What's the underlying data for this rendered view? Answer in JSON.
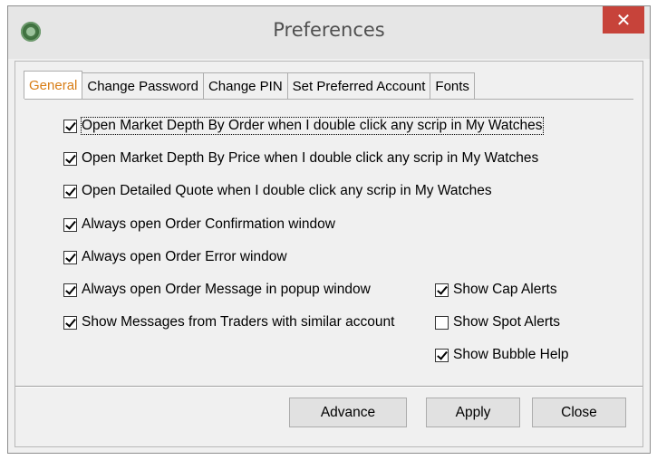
{
  "window": {
    "title": "Preferences",
    "close_glyph": "✕",
    "app_icon": "app-logo-icon"
  },
  "tabs": [
    {
      "label": "General",
      "active": true
    },
    {
      "label": "Change Password",
      "active": false
    },
    {
      "label": "Change PIN",
      "active": false
    },
    {
      "label": "Set Preferred Account",
      "active": false
    },
    {
      "label": "Fonts",
      "active": false
    }
  ],
  "options_left": [
    {
      "label": "Open Market Depth By Order when I double click any scrip in My Watches",
      "checked": true
    },
    {
      "label": "Open Market Depth By Price when I double click any scrip in My Watches",
      "checked": true
    },
    {
      "label": "Open Detailed Quote when I double click any scrip in My Watches",
      "checked": true
    },
    {
      "label": "Always open Order Confirmation window",
      "checked": true
    },
    {
      "label": "Always open Order Error window",
      "checked": true
    },
    {
      "label": "Always open Order Message in popup window",
      "checked": true
    },
    {
      "label": "Show Messages from Traders with similar account",
      "checked": true
    }
  ],
  "options_right": [
    {
      "label": "Show Cap Alerts",
      "checked": true
    },
    {
      "label": "Show Spot Alerts",
      "checked": false
    },
    {
      "label": "Show Bubble Help",
      "checked": true
    }
  ],
  "buttons": {
    "advance": "Advance",
    "apply": "Apply",
    "close": "Close"
  },
  "colors": {
    "active_tab_text": "#d87d15",
    "close_button": "#c7433a"
  }
}
